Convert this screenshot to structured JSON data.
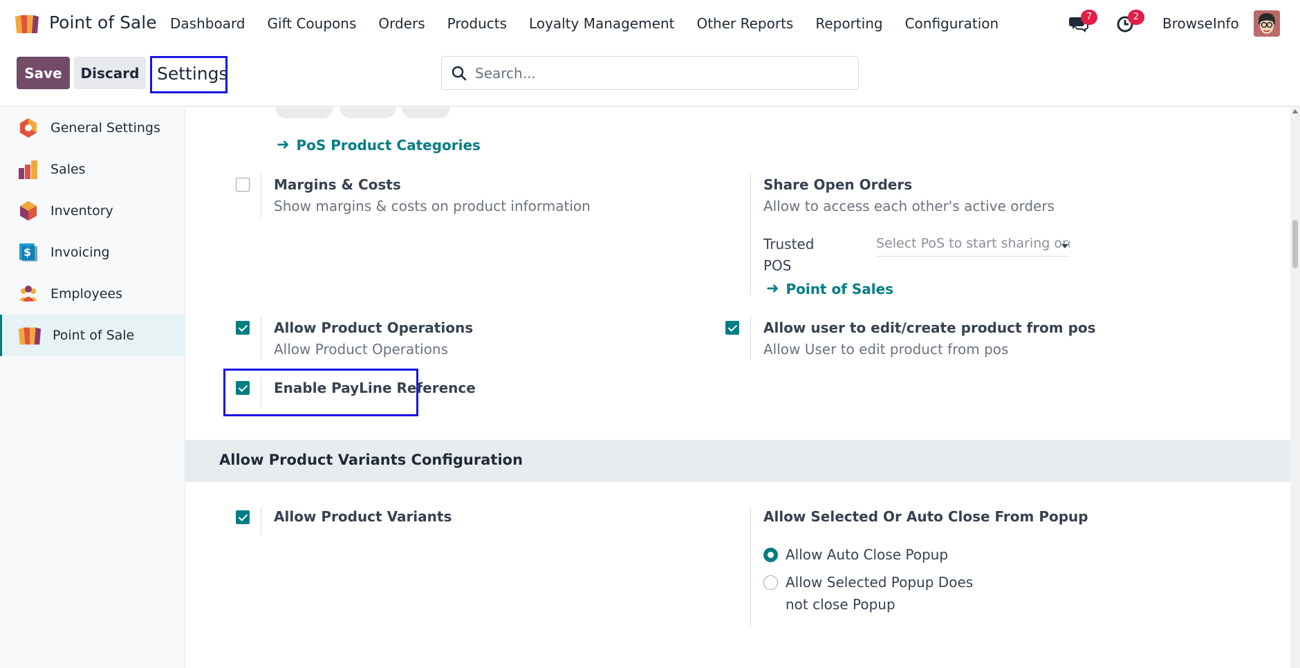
{
  "navbar": {
    "app_name": "Point of Sale",
    "menu": [
      "Dashboard",
      "Gift Coupons",
      "Orders",
      "Products",
      "Loyalty Management",
      "Other Reports",
      "Reporting",
      "Configuration"
    ],
    "messages_count": "7",
    "activities_count": "2",
    "company": "BrowseInfo"
  },
  "controlbar": {
    "save_label": "Save",
    "discard_label": "Discard",
    "breadcrumb": "Settings",
    "search_placeholder": "Search..."
  },
  "sidebar": {
    "items": [
      {
        "label": "General Settings",
        "icon": "general-settings-icon"
      },
      {
        "label": "Sales",
        "icon": "sales-icon"
      },
      {
        "label": "Inventory",
        "icon": "inventory-icon"
      },
      {
        "label": "Invoicing",
        "icon": "invoicing-icon"
      },
      {
        "label": "Employees",
        "icon": "employees-icon"
      },
      {
        "label": "Point of Sale",
        "icon": "point-of-sale-icon",
        "active": true
      }
    ]
  },
  "settings": {
    "pos_product_categories_link": "PoS Product Categories",
    "margins": {
      "title": "Margins & Costs",
      "desc": "Show margins & costs on product information",
      "checked": false
    },
    "share_orders": {
      "title": "Share Open Orders",
      "desc": "Allow to access each other's active orders",
      "trusted_label_1": "Trusted",
      "trusted_label_2": "POS",
      "select_placeholder": "Select PoS to start sharing orders",
      "link": "Point of Sales"
    },
    "product_operations": {
      "title": "Allow Product Operations",
      "desc": "Allow Product Operations",
      "checked": true
    },
    "edit_product": {
      "title": "Allow user to edit/create product from pos",
      "desc": "Allow User to edit product from pos",
      "checked": true
    },
    "payline": {
      "title": "Enable PayLine Reference",
      "checked": true
    }
  },
  "variants_section": {
    "title": "Allow Product Variants Configuration",
    "product_variants": {
      "title": "Allow Product Variants",
      "checked": true
    },
    "popup": {
      "title": "Allow Selected Or Auto Close From Popup",
      "option_1": "Allow Auto Close Popup",
      "option_2_line_1": "Allow Selected Popup Does",
      "option_2_line_2": "not close Popup",
      "selected": "option_1"
    }
  },
  "colors": {
    "brand": "#714b67",
    "accent": "#017e84",
    "highlight": "#1a12e6",
    "badge": "#e11d48"
  }
}
